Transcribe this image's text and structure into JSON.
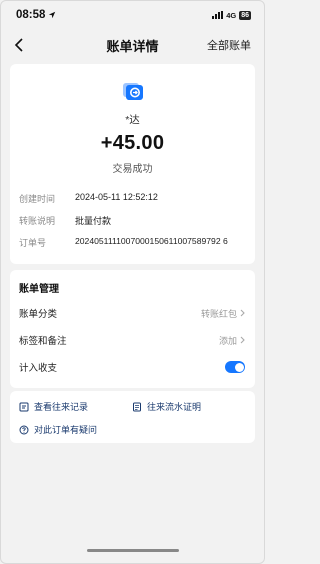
{
  "status_bar": {
    "time": "08:58",
    "network": "4G",
    "battery": "86"
  },
  "nav": {
    "title": "账单详情",
    "right_label": "全部账单"
  },
  "summary": {
    "payee": "*达",
    "amount": "+45.00",
    "status": "交易成功",
    "details": [
      {
        "label": "创建时间",
        "value": "2024-05-11 12:52:12"
      },
      {
        "label": "转账说明",
        "value": "批量付款"
      },
      {
        "label": "订单号",
        "value": "2024051111007000150611007589792 6"
      }
    ]
  },
  "manage": {
    "title": "账单管理",
    "category": {
      "label": "账单分类",
      "value": "转账红包"
    },
    "tags": {
      "label": "标签和备注",
      "value": "添加"
    },
    "income": {
      "label": "计入收支",
      "on": true
    }
  },
  "links": {
    "history": "查看往来记录",
    "proof": "往来流水证明",
    "question": "对此订单有疑问"
  },
  "colors": {
    "accent": "#1677ff",
    "link": "#1a3a6e"
  }
}
